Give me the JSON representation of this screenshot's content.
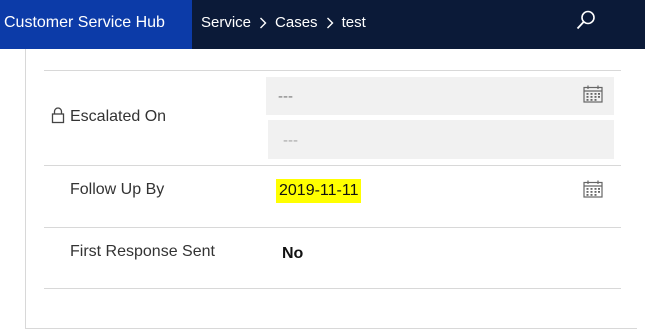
{
  "app": {
    "title": "Customer Service Hub"
  },
  "breadcrumb": {
    "items": [
      "Service",
      "Cases",
      "test"
    ]
  },
  "fields": {
    "escalated_on": {
      "label": "Escalated On",
      "date_placeholder": "---",
      "time_placeholder": "---",
      "locked": true
    },
    "follow_up_by": {
      "label": "Follow Up By",
      "value": "2019-11-11"
    },
    "first_response_sent": {
      "label": "First Response Sent",
      "value": "No"
    }
  },
  "colors": {
    "app_title_bg": "#0c3ba8",
    "topbar_bg": "#0b1a38",
    "highlight": "#ffff00"
  },
  "icons": [
    "search-icon",
    "chevron-right-icon",
    "lock-icon",
    "calendar-icon"
  ]
}
